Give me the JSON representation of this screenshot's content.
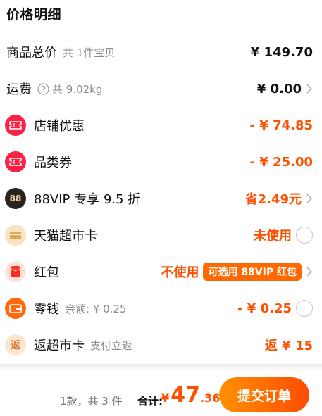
{
  "section_title": "价格明细",
  "goods_total": {
    "label": "商品总价",
    "sub": "共 1件宝贝",
    "amount": "¥ 149.70"
  },
  "shipping": {
    "label": "运费",
    "sub": "共 9.02kg",
    "amount": "¥ 0.00"
  },
  "shop_discount": {
    "label": "店铺优惠",
    "amount": "- ¥ 74.85"
  },
  "category_coupon": {
    "label": "品类券",
    "amount": "- ¥ 25.00"
  },
  "vip": {
    "label": "88VIP 专享 9.5 折",
    "icon_text": "88",
    "value": "省2.49元"
  },
  "tmall_card": {
    "label": "天猫超市卡",
    "status": "未使用"
  },
  "red_packet": {
    "label": "红包",
    "status": "不使用",
    "badge": "可选用 88VIP 红包"
  },
  "change": {
    "label": "零钱",
    "sub": "余额: ¥ 0.25",
    "amount": "- ¥ 0.25"
  },
  "cashback": {
    "label": "返超市卡",
    "sub": "支付立返",
    "value": "返 ¥ 15",
    "icon_text": "返"
  },
  "footer": {
    "count_text": "1款，共 3 件",
    "total_label": "合计:",
    "currency": "¥",
    "price_int": "47",
    "price_dec": ".36",
    "submit_label": "提交订单"
  },
  "colors": {
    "accent": "#ff5000",
    "coupon_red": "#ff2043",
    "vip_bg": "#2a2320",
    "gold_bg": "#f6e3c4"
  }
}
